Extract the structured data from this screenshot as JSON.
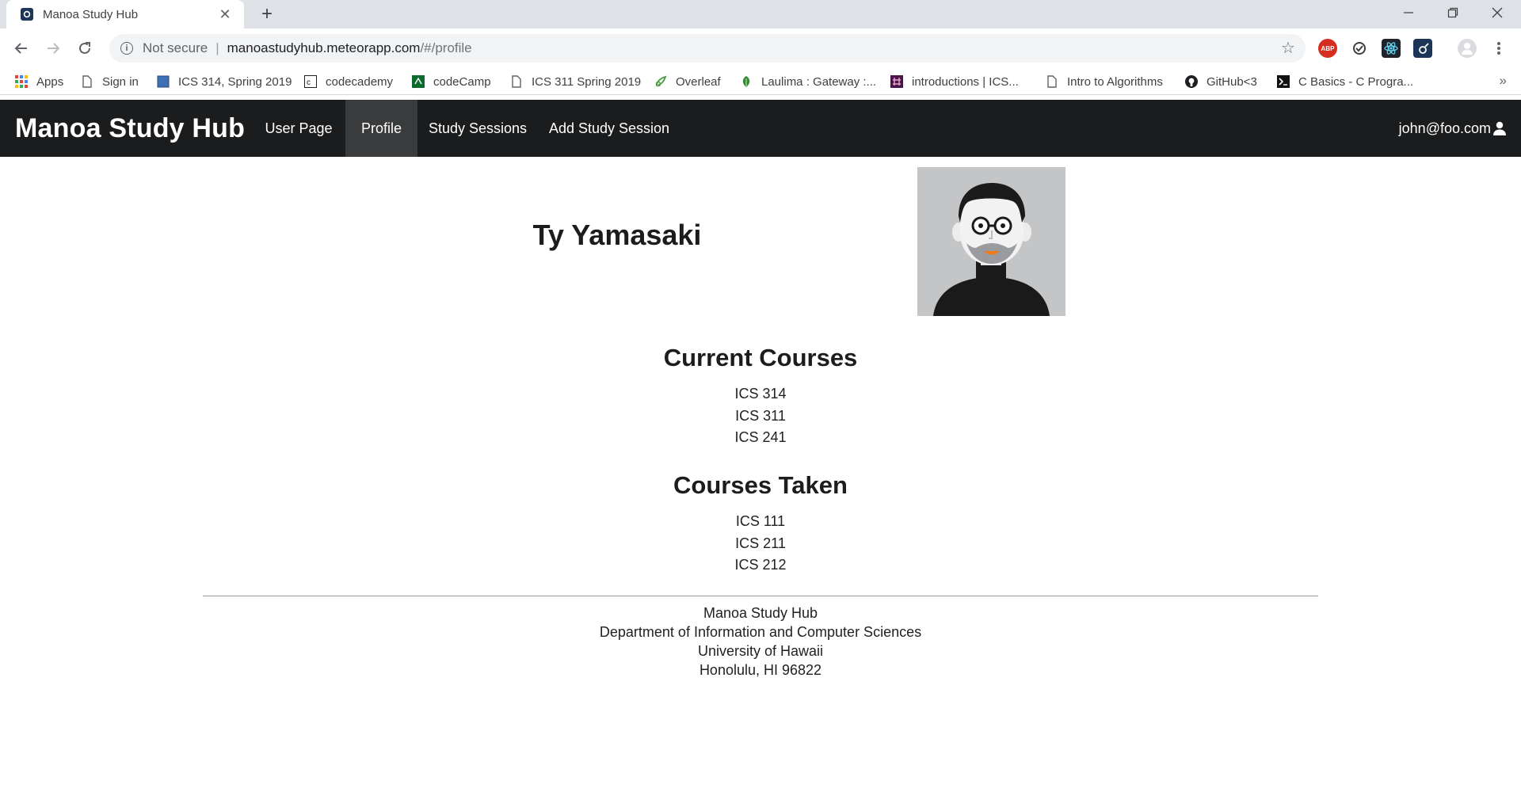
{
  "browser": {
    "tab": {
      "title": "Manoa Study Hub"
    },
    "address": {
      "security": "Not secure",
      "host": "manoastudyhub.meteorapp.com",
      "path": "/#/profile"
    },
    "bookmarks": [
      {
        "label": "Apps",
        "icon": "apps-grid-icon"
      },
      {
        "label": "Sign in",
        "icon": "page-icon"
      },
      {
        "label": "ICS 314, Spring 2019",
        "icon": "square-icon"
      },
      {
        "label": "codecademy",
        "icon": "codecademy-icon"
      },
      {
        "label": "codeCamp",
        "icon": "codecamp-icon"
      },
      {
        "label": "ICS 311 Spring 2019",
        "icon": "page-icon"
      },
      {
        "label": "Overleaf",
        "icon": "overleaf-icon"
      },
      {
        "label": "Laulima : Gateway :...",
        "icon": "leaf-icon"
      },
      {
        "label": "introductions | ICS...",
        "icon": "slack-icon"
      },
      {
        "label": "Intro to Algorithms",
        "icon": "page-icon"
      },
      {
        "label": "GitHub<3",
        "icon": "github-icon"
      },
      {
        "label": "C Basics - C Progra...",
        "icon": "terminal-icon"
      }
    ],
    "overflow_label": "»"
  },
  "app": {
    "brand": "Manoa Study Hub",
    "nav": [
      {
        "label": "User Page",
        "active": false
      },
      {
        "label": "Profile",
        "active": true
      },
      {
        "label": "Study Sessions",
        "active": false
      },
      {
        "label": "Add Study Session",
        "active": false
      }
    ],
    "user_email": "john@foo.com"
  },
  "profile": {
    "name": "Ty Yamasaki",
    "current_courses_title": "Current Courses",
    "current_courses": [
      "ICS 314",
      "ICS 311",
      "ICS 241"
    ],
    "courses_taken_title": "Courses Taken",
    "courses_taken": [
      "ICS 111",
      "ICS 211",
      "ICS 212"
    ]
  },
  "footer": {
    "lines": [
      "Manoa Study Hub",
      "Department of Information and Computer Sciences",
      "University of Hawaii",
      "Honolulu, HI 96822"
    ]
  },
  "colors": {
    "navbar": "#1b1c1d",
    "nav_active": "#3a3b3c",
    "chrome_tabstrip": "#dee1e6"
  }
}
